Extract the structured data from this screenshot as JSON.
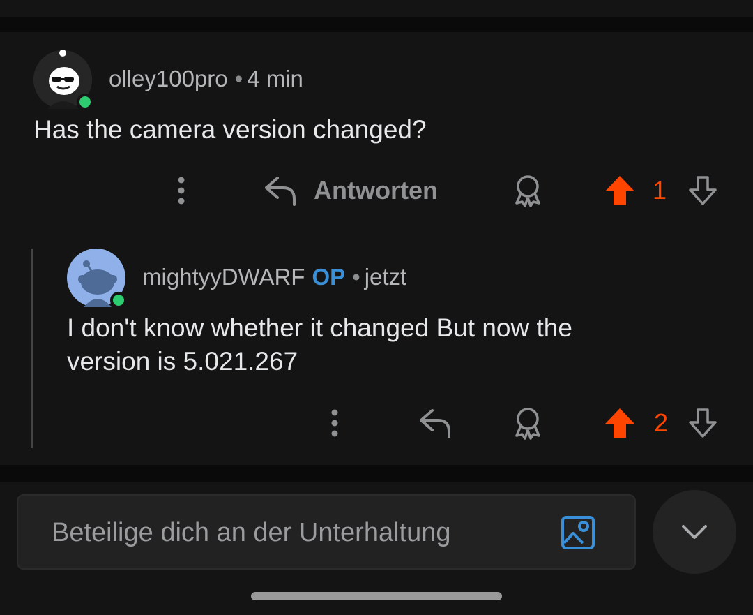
{
  "comments": [
    {
      "username": "olley100pro",
      "is_op": false,
      "time": "4 min",
      "body_lines": [
        "Has the camera version changed?"
      ],
      "reply_label": "Antworten",
      "score": "1",
      "online": true
    },
    {
      "username": "mightyyDWARF",
      "is_op": true,
      "op_label": "OP",
      "time": "jetzt",
      "body_lines": [
        "I don't know whether it changed But now the",
        "version is 5.021.267"
      ],
      "score": "2",
      "online": true
    }
  ],
  "separator": "•",
  "composer": {
    "placeholder": "Beteilige dich an der Unterhaltung"
  },
  "colors": {
    "background": "#141414",
    "upvote_active": "#ff4500",
    "op_badge": "#3a8fd9",
    "online": "#2ecc71",
    "image_icon": "#3a8fd9"
  },
  "icons": {
    "more": "more-vertical-icon",
    "reply": "reply-arrow-icon",
    "award": "award-ribbon-icon",
    "upvote": "upvote-arrow-icon",
    "downvote": "downvote-arrow-icon",
    "image": "image-upload-icon",
    "collapse": "chevron-down-icon"
  }
}
